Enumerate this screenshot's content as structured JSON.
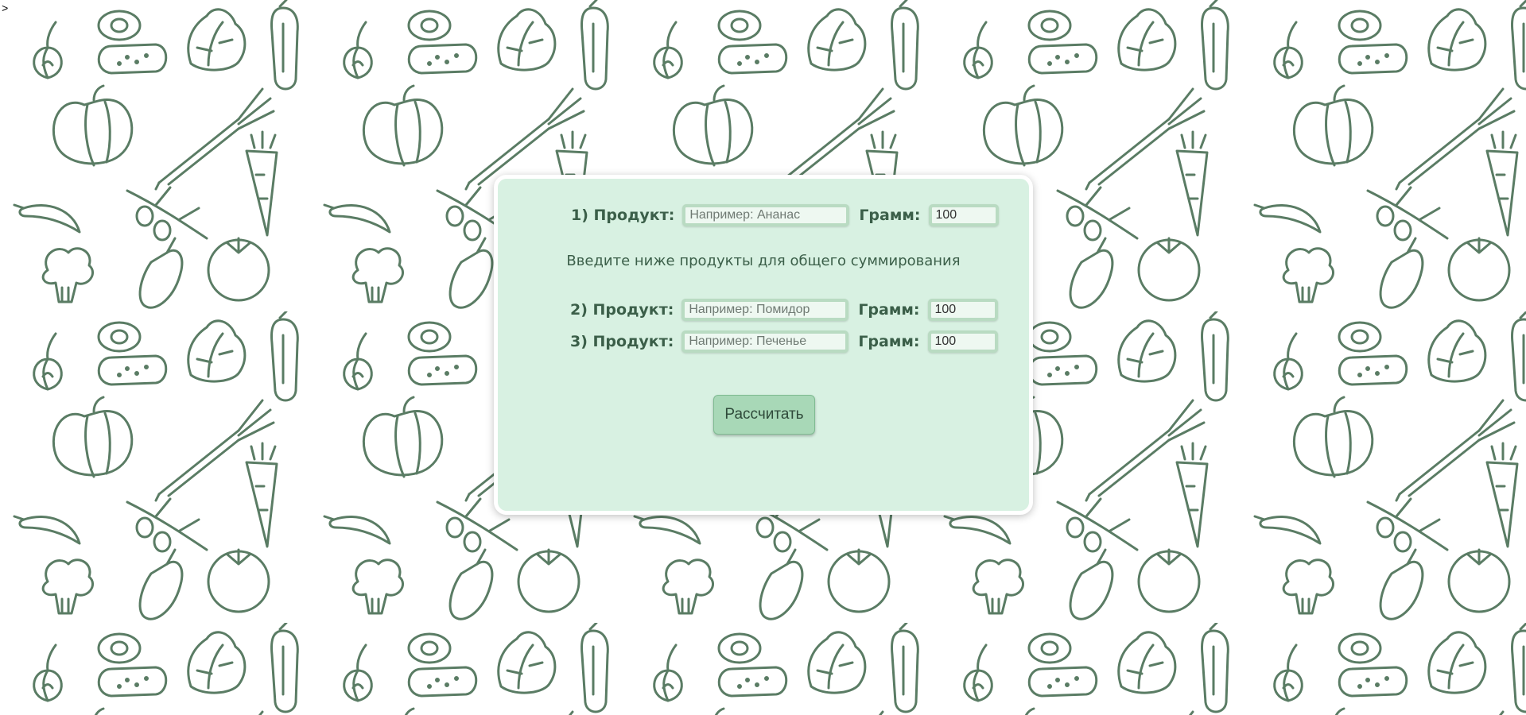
{
  "page": {
    "corner_glyph": ">"
  },
  "background": {
    "pattern": "vegetable-doodles",
    "icons": [
      "onion-icon",
      "avocado-icon",
      "lettuce-icon",
      "zucchini-icon",
      "pepper-icon",
      "leek-icon",
      "carrot-icon",
      "chili-icon",
      "olive-icon",
      "tomato-icon",
      "broccoli-icon",
      "eggplant-icon",
      "mushroom-icon",
      "ginger-icon"
    ],
    "line_color": "#5a7c64",
    "bg_color": "#ffffff"
  },
  "form": {
    "card_color": "#d8f1e2",
    "rows": [
      {
        "product_label": "1) Продукт:",
        "product_placeholder": "Например: Ананас",
        "product_value": "",
        "gram_label": "Грамм:",
        "gram_value": "100"
      },
      {
        "product_label": "2) Продукт:",
        "product_placeholder": "Например: Помидор",
        "product_value": "",
        "gram_label": "Грамм:",
        "gram_value": "100"
      },
      {
        "product_label": "3) Продукт:",
        "product_placeholder": "Например: Печенье",
        "product_value": "",
        "gram_label": "Грамм:",
        "gram_value": "100"
      }
    ],
    "hint": "Введите ниже продукты для общего суммирования",
    "submit_label": "Рассчитать"
  }
}
